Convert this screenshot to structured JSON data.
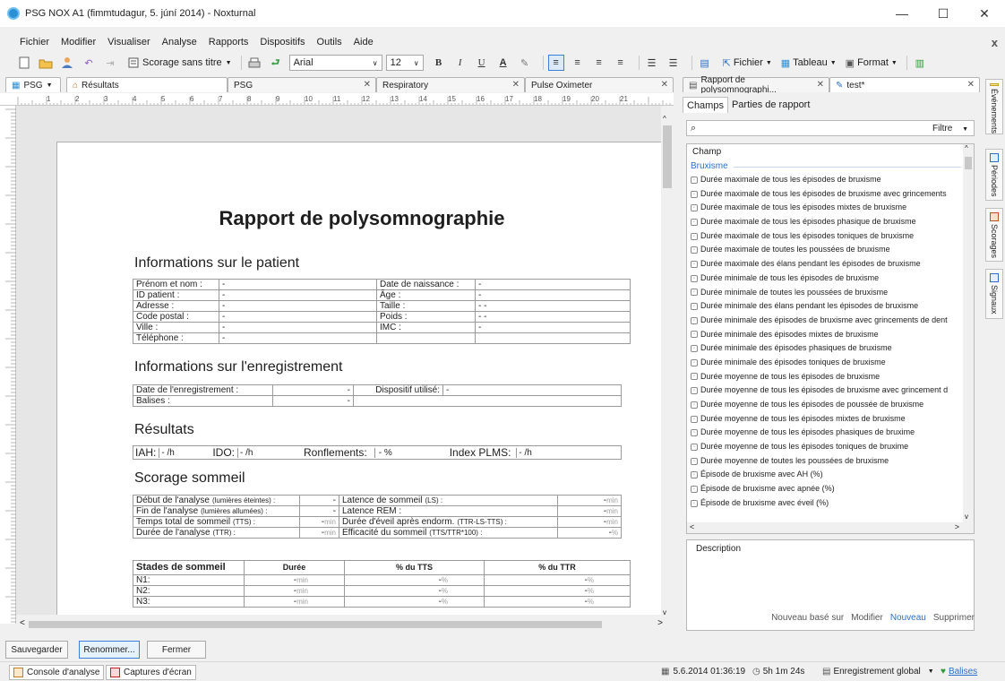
{
  "window": {
    "title": "PSG NOX A1 (fimmtudagur, 5. júní 2014) - Noxturnal",
    "minimize": "—",
    "maximize": "☐",
    "close": "✕"
  },
  "menu": {
    "items": [
      "Fichier",
      "Modifier",
      "Visualiser",
      "Analyse",
      "Rapports",
      "Dispositifs",
      "Outils",
      "Aide"
    ],
    "close_child": "x"
  },
  "toolbar": {
    "scoring_label": "Scorage sans titre",
    "font_name": "Arial",
    "font_size": "12",
    "bold": "B",
    "italic": "I",
    "underline": "U",
    "font_color": "A",
    "file_menu": "Fichier",
    "table_menu": "Tableau",
    "format_menu": "Format"
  },
  "tabs": {
    "psg_dropdown": "PSG",
    "items": [
      {
        "label": "Résultats",
        "active": true,
        "closable": false
      },
      {
        "label": "PSG",
        "active": false,
        "closable": true
      },
      {
        "label": "Respiratory",
        "active": false,
        "closable": true
      },
      {
        "label": "Pulse Oximeter",
        "active": false,
        "closable": true
      }
    ],
    "right_items": [
      {
        "label": "Rapport de polysomnographi...",
        "active": false
      },
      {
        "label": "test*",
        "active": true
      }
    ]
  },
  "ruler": {
    "marks": [
      "1",
      "2",
      "3",
      "4",
      "5",
      "6",
      "7",
      "8",
      "9",
      "10",
      "11",
      "12",
      "13",
      "14",
      "15",
      "16",
      "17",
      "18",
      "19",
      "20",
      "21"
    ]
  },
  "report": {
    "title": "Rapport de polysomnographie",
    "patient_section": "Informations sur le patient",
    "patient_rows": [
      {
        "l1": "Prénom et nom :",
        "v1": "-",
        "l2": "Date de naissance :",
        "v2": "-"
      },
      {
        "l1": "ID patient :",
        "v1": "-",
        "l2": "Âge :",
        "v2": "-"
      },
      {
        "l1": "Adresse :",
        "v1": "-",
        "l2": "Taille :",
        "v2": "- -"
      },
      {
        "l1": "Code postal :",
        "v1": "-",
        "l2": "Poids :",
        "v2": "- -"
      },
      {
        "l1": "Ville :",
        "v1": "-",
        "l2": "IMC :",
        "v2": "-"
      },
      {
        "l1": "Téléphone :",
        "v1": "-",
        "l2": "",
        "v2": ""
      }
    ],
    "recording_section": "Informations sur l'enregistrement",
    "recording_rows": [
      {
        "l1": "Date de l'enregistrement :",
        "v1": "-",
        "l2": "Dispositif utilisé:",
        "v2": "-"
      },
      {
        "l1": "Balises :",
        "v1": "-",
        "l2": "",
        "v2": ""
      }
    ],
    "results_section": "Résultats",
    "results": {
      "iah_label": "IAH:",
      "iah_value": "- /h",
      "ido_label": "IDO:",
      "ido_value": "- /h",
      "ronf_label": "Ronflements:",
      "ronf_value": "- %",
      "plms_label": "Index PLMS:",
      "plms_value": "- /h"
    },
    "sleep_section": "Scorage sommeil",
    "sleep_rows": [
      {
        "l1": "Début de l'analyse",
        "l1s": "(lumières éteintes) :",
        "v1": "-",
        "u1": "",
        "l2": "Latence de sommeil",
        "l2s": "(LS) :",
        "v2": "-",
        "u2": "min"
      },
      {
        "l1": "Fin de l'analyse",
        "l1s": "(lumières allumées) :",
        "v1": "-",
        "u1": "",
        "l2": "Latence REM :",
        "l2s": "",
        "v2": "-",
        "u2": "min"
      },
      {
        "l1": "Temps total de sommeil",
        "l1s": "(TTS) :",
        "v1": "-",
        "u1": "min",
        "l2": "Durée d'éveil après endorm.",
        "l2s": "(TTR-LS-TTS) :",
        "v2": "-",
        "u2": "min"
      },
      {
        "l1": "Durée de l'analyse",
        "l1s": "(TTR) :",
        "v1": "-",
        "u1": "min",
        "l2": "Efficacité du sommeil",
        "l2s": "(TTS/TTR*100) :",
        "v2": "-",
        "u2": "%"
      }
    ],
    "stages_header": {
      "h0": "Stades de sommeil",
      "h1": "Durée",
      "h2": "% du TTS",
      "h3": "% du TTR"
    },
    "stages": [
      {
        "name": "N1:",
        "d": "-",
        "du": "min",
        "t": "-",
        "tu": "%",
        "r": "-",
        "ru": "%"
      },
      {
        "name": "N2:",
        "d": "-",
        "du": "min",
        "t": "-",
        "tu": "%",
        "r": "-",
        "ru": "%"
      },
      {
        "name": "N3:",
        "d": "-",
        "du": "min",
        "t": "-",
        "tu": "%",
        "r": "-",
        "ru": "%"
      }
    ]
  },
  "right_panel": {
    "tab_fields": "Champs",
    "tab_parts": "Parties de rapport",
    "filter": "Filtre",
    "list_header": "Champ",
    "group": "Bruxisme",
    "items": [
      "Durée maximale de tous les épisodes de bruxisme",
      "Durée maximale de tous les épisodes de bruxisme avec grincements",
      "Durée maximale de tous les épisodes mixtes de bruxisme",
      "Durée maximale de tous les épisodes phasique de bruxisme",
      "Durée maximale de tous les épisodes toniques de bruxisme",
      "Durée maximale de toutes les poussées de bruxisme",
      "Durée maximale des élans pendant les épisodes de bruxisme",
      "Durée minimale de tous les épisodes de bruxisme",
      "Durée minimale de toutes les poussées de bruxisme",
      "Durée minimale des élans pendant les épisodes de bruxisme",
      "Durée minimale des épisodes de bruxisme avec grincements de dent",
      "Durée minimale des épisodes mixtes de bruxisme",
      "Durée minimale des épisodes phasiques de bruxisme",
      "Durée minimale des épisodes toniques de bruxisme",
      "Durée moyenne de tous les épisodes de bruxisme",
      "Durée moyenne de tous les épisodes de bruxisme avec grincement d",
      "Durée moyenne de tous les épisodes de poussée de bruxisme",
      "Durée moyenne de tous les épisodes mixtes de bruxisme",
      "Durée moyenne de tous les épisodes phasiques de bruxime",
      "Durée moyenne de tous les épisodes toniques de bruxime",
      "Durée moyenne de toutes les poussées de bruxisme",
      "Épisode de bruxisme avec AH (%)",
      "Épisode de bruxisme avec apnée (%)",
      "Épisode de bruxisme avec éveil (%)"
    ],
    "description_label": "Description",
    "links": {
      "new_based": "Nouveau basé sur",
      "modify": "Modifier",
      "new": "Nouveau",
      "delete": "Supprimer"
    }
  },
  "side_tabs": [
    "Événements",
    "Périodes",
    "Scorages",
    "Signaux"
  ],
  "bottom_buttons": {
    "save": "Sauvegarder",
    "rename": "Renommer...",
    "close": "Fermer"
  },
  "status": {
    "console_tab": "Console d'analyse",
    "screenshots_tab": "Captures d'écran",
    "datetime": "5.6.2014 01:36:19",
    "duration": "5h 1m 24s",
    "recording_mode": "Enregistrement global",
    "markers": "Balises"
  },
  "colors": {
    "accent": "#2b6fc8",
    "link": "#2b6fc8"
  }
}
